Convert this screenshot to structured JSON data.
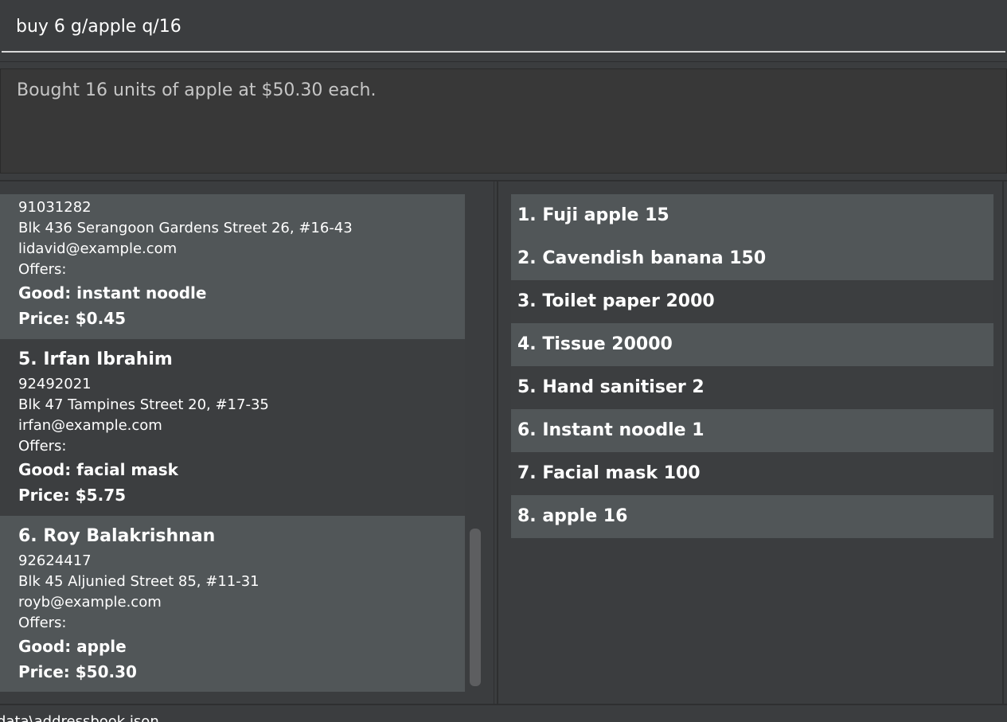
{
  "command": {
    "value": "buy 6 g/apple q/16"
  },
  "result": {
    "text": "Bought 16 units of apple at $50.30 each."
  },
  "suppliers": [
    {
      "index_name": "",
      "phone": "91031282",
      "address": "Blk 436 Serangoon Gardens Street 26, #16-43",
      "email": "lidavid@example.com",
      "offers_label": "Offers:",
      "good": "Good: instant noodle",
      "price": "Price: $0.45"
    },
    {
      "index_name": "5.  Irfan Ibrahim",
      "phone": "92492021",
      "address": "Blk 47 Tampines Street 20, #17-35",
      "email": "irfan@example.com",
      "offers_label": "Offers:",
      "good": "Good: facial mask",
      "price": "Price: $5.75"
    },
    {
      "index_name": "6.  Roy Balakrishnan",
      "phone": "92624417",
      "address": "Blk 45 Aljunied Street 85, #11-31",
      "email": "royb@example.com",
      "offers_label": "Offers:",
      "good": "Good: apple",
      "price": "Price: $50.30"
    }
  ],
  "inventory": [
    "1.  Fuji apple 15",
    "2.  Cavendish banana 150",
    "3.  Toilet paper 2000",
    "4.  Tissue 20000",
    "5.  Hand sanitiser 2",
    "6.  Instant noodle 1",
    "7.  Facial mask 100",
    "8.  apple 16"
  ],
  "status": {
    "text": "data\\addressbook.json"
  }
}
